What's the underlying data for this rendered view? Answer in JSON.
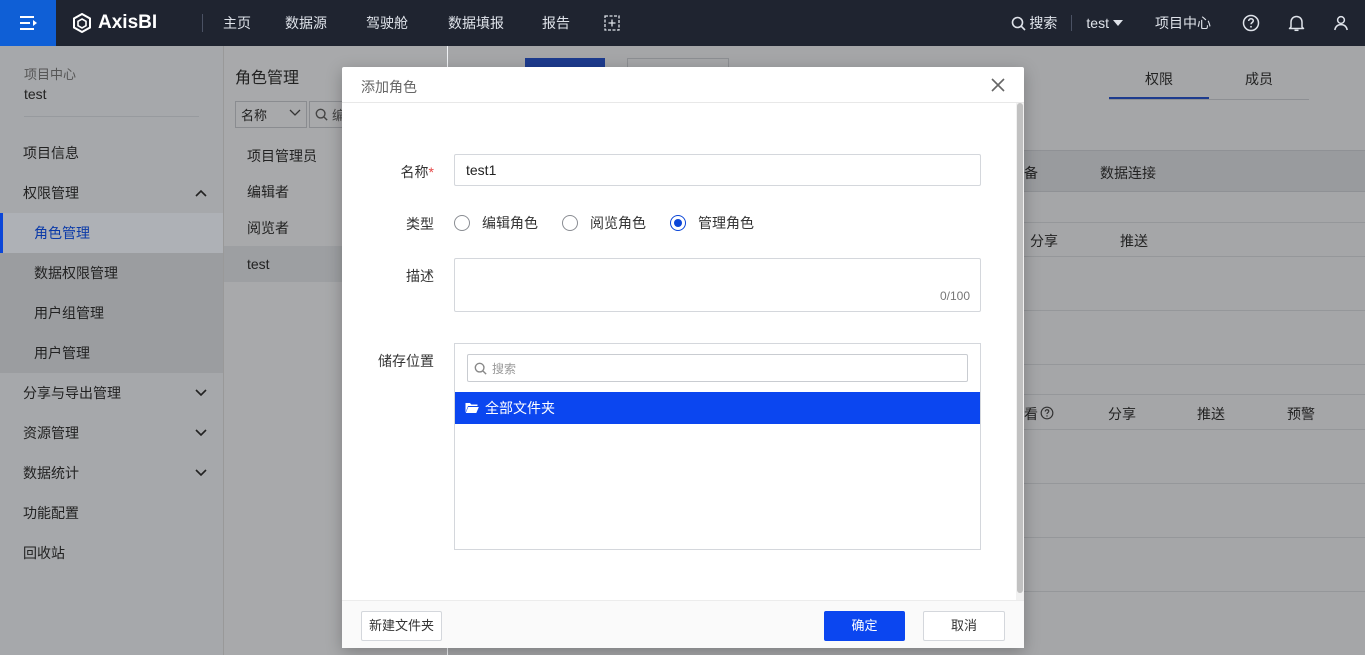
{
  "topbar": {
    "logo_text": "AxisBI",
    "nav": [
      "主页",
      "数据源",
      "驾驶舱",
      "数据填报",
      "报告"
    ],
    "search_label": "搜索",
    "user": "test",
    "project_center": "项目中心"
  },
  "sidebar": {
    "subtitle": "项目中心",
    "project": "test",
    "items": {
      "project_info": "项目信息",
      "permission": "权限管理",
      "role": "角色管理",
      "data_permission": "数据权限管理",
      "user_group": "用户组管理",
      "user": "用户管理",
      "share_export": "分享与导出管理",
      "resource": "资源管理",
      "stats": "数据统计",
      "feature": "功能配置",
      "recycle": "回收站"
    }
  },
  "role_panel": {
    "title": "角色管理",
    "filter_select": "名称",
    "search_partial": "编",
    "roles": [
      "项目管理员",
      "编辑者",
      "阅览者",
      "test"
    ]
  },
  "content": {
    "tabs": [
      "权限",
      "成员"
    ],
    "header_cells": [
      "备",
      "数据连接"
    ],
    "row1_cells": [
      "分享",
      "推送"
    ],
    "row2_cells": [
      "看",
      "分享",
      "推送",
      "预警"
    ]
  },
  "modal": {
    "title": "添加角色",
    "name_label": "名称",
    "required_mark": "*",
    "name_value": "test1",
    "type_label": "类型",
    "type_options": [
      "编辑角色",
      "阅览角色",
      "管理角色"
    ],
    "type_selected": "管理角色",
    "desc_label": "描述",
    "desc_count": "0/100",
    "storage_label": "储存位置",
    "folder_search_placeholder": "搜索",
    "folder_item": "全部文件夹",
    "new_folder_btn": "新建文件夹",
    "ok_btn": "确定",
    "cancel_btn": "取消"
  },
  "colors": {
    "accent": "#0b46f0",
    "topbar": "#1f2430",
    "menu_btn": "#0f5fd6"
  }
}
